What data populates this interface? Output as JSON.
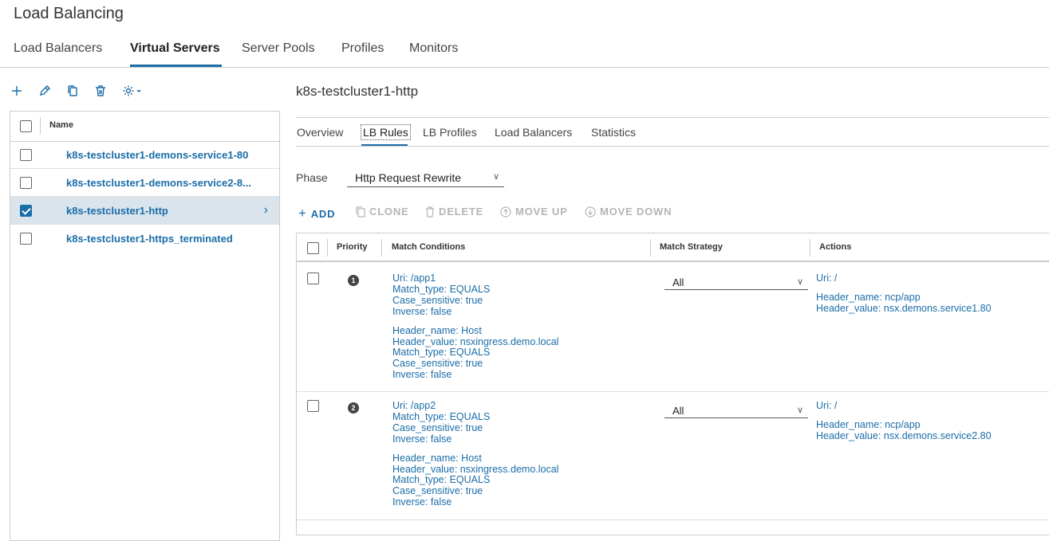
{
  "page": {
    "title": "Load Balancing"
  },
  "nav": {
    "tabs": [
      "Load Balancers",
      "Virtual Servers",
      "Server Pools",
      "Profiles",
      "Monitors"
    ],
    "active": "Virtual Servers"
  },
  "toolbar": {
    "icons": [
      "plus-icon",
      "pencil-icon",
      "copy-icon",
      "trash-icon",
      "gear-icon"
    ]
  },
  "list": {
    "header": "Name",
    "items": [
      {
        "label": "k8s-testcluster1-demons-service1-80",
        "checked": false
      },
      {
        "label": "k8s-testcluster1-demons-service2-8...",
        "checked": false
      },
      {
        "label": "k8s-testcluster1-http",
        "checked": true
      },
      {
        "label": "k8s-testcluster1-https_terminated",
        "checked": false
      }
    ]
  },
  "detail": {
    "title": "k8s-testcluster1-http",
    "tabs": [
      "Overview",
      "LB Rules",
      "LB Profiles",
      "Load Balancers",
      "Statistics"
    ],
    "active_tab": "LB Rules",
    "phase_label": "Phase",
    "phase_value": "Http Request Rewrite",
    "actions": {
      "add": "ADD",
      "clone": "CLONE",
      "delete": "DELETE",
      "move_up": "MOVE UP",
      "move_down": "MOVE DOWN"
    }
  },
  "rules_table": {
    "columns": [
      "Priority",
      "Match Conditions",
      "Match Strategy",
      "Actions"
    ],
    "rows": [
      {
        "priority": "1",
        "conditions": [
          [
            "Uri: /app1",
            "Match_type: EQUALS",
            "Case_sensitive: true",
            "Inverse: false"
          ],
          [
            "Header_name: Host",
            "Header_value: nsxingress.demo.local",
            "Match_type: EQUALS",
            "Case_sensitive: true",
            "Inverse: false"
          ]
        ],
        "strategy": "All",
        "actions": [
          [
            "Uri: /"
          ],
          [
            "Header_name: ncp/app",
            "Header_value: nsx.demons.service1.80"
          ]
        ]
      },
      {
        "priority": "2",
        "conditions": [
          [
            "Uri: /app2",
            "Match_type: EQUALS",
            "Case_sensitive: true",
            "Inverse: false"
          ],
          [
            "Header_name: Host",
            "Header_value: nsxingress.demo.local",
            "Match_type: EQUALS",
            "Case_sensitive: true",
            "Inverse: false"
          ]
        ],
        "strategy": "All",
        "actions": [
          [
            "Uri: /"
          ],
          [
            "Header_name: ncp/app",
            "Header_value: nsx.demons.service2.80"
          ]
        ]
      }
    ]
  },
  "colors": {
    "accent": "#1b6da8",
    "selected_row": "#d9e4ec",
    "disabled": "#b5b5b5"
  }
}
